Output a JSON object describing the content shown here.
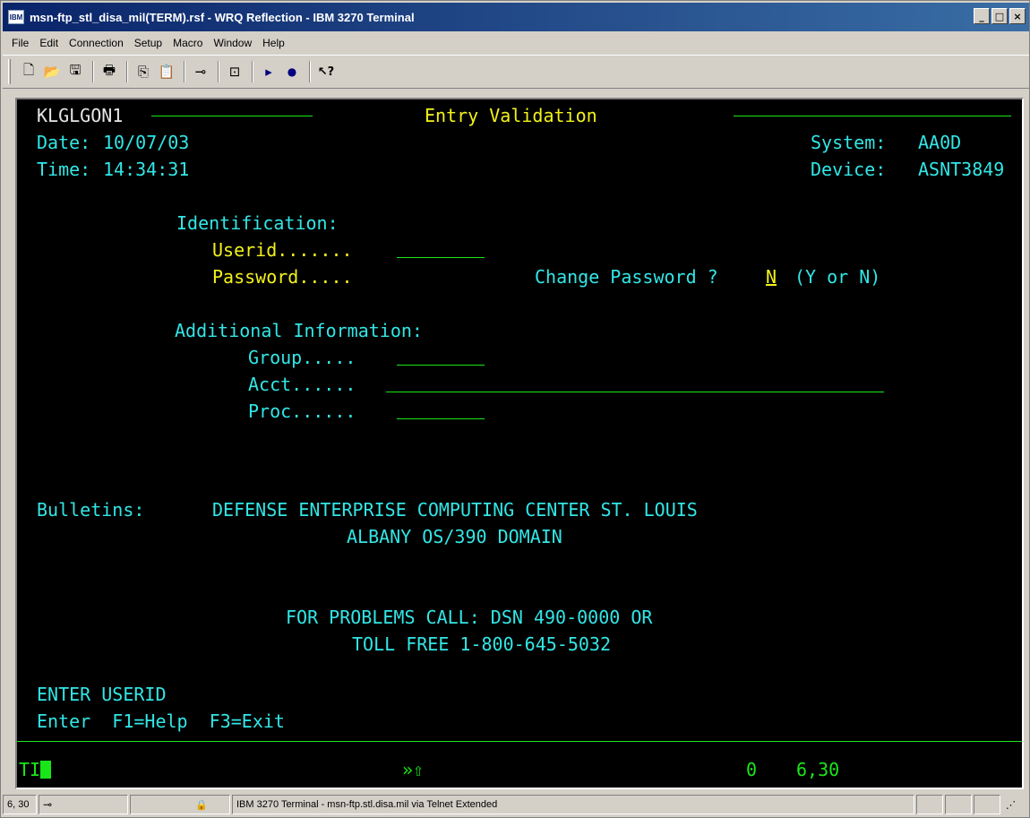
{
  "window": {
    "title": "msn-ftp_stl_disa_mil(TERM).rsf - WRQ Reflection - IBM 3270 Terminal",
    "app_icon_label": "IBM",
    "buttons": {
      "minimize": "_",
      "maximize": "□",
      "close": "×"
    }
  },
  "menu": [
    "File",
    "Edit",
    "Connection",
    "Setup",
    "Macro",
    "Window",
    "Help"
  ],
  "toolbar": {
    "icons": [
      "new-file-icon",
      "open-folder-icon",
      "save-icon",
      "print-icon",
      "copy-icon",
      "paste-icon",
      "connect-icon",
      "disconnect-icon",
      "play-macro-icon",
      "record-macro-icon",
      "context-help-icon"
    ],
    "glyphs": {
      "new": "🗋",
      "open": "📂",
      "save": "🖫",
      "print": "🖶",
      "copy": "⎘",
      "paste": "📋",
      "connect": "⊸",
      "disconnect": "⊡",
      "play": "▸",
      "record": "●",
      "help": "↖?"
    }
  },
  "terminal": {
    "screen_id": "KLGLGON1",
    "title": "Entry Validation",
    "date_label": "Date:",
    "date_value": "10/07/03",
    "time_label": "Time:",
    "time_value": "14:34:31",
    "system_label": "System:",
    "system_value": "AA0D",
    "device_label": "Device:",
    "device_value": "ASNT3849",
    "identification_heading": "Identification:",
    "userid_label": "Userid.......",
    "password_label": "Password.....",
    "change_password_label": "Change Password ?",
    "change_password_value": "N",
    "change_password_hint": "(Y or N)",
    "additional_heading": "Additional Information:",
    "group_label": "Group.....",
    "acct_label": "Acct......",
    "proc_label": "Proc......",
    "bulletins_label": "Bulletins:",
    "bulletin_line1": "DEFENSE ENTERPRISE COMPUTING CENTER ST. LOUIS",
    "bulletin_line2": "ALBANY OS/390 DOMAIN",
    "problems_line1": "FOR PROBLEMS CALL: DSN 490-0000 OR",
    "problems_line2": "TOLL FREE 1-800-645-5032",
    "message": "ENTER USERID",
    "pf_keys": "Enter  F1=Help  F3=Exit"
  },
  "oia": {
    "indicator": "TI",
    "shift_symbol": "»⇧",
    "status_number": "0",
    "cursor_pos": "6,30"
  },
  "statusbar": {
    "cursor_pos": "6, 30",
    "connection_text": "IBM 3270 Terminal - msn-ftp.stl.disa.mil via Telnet Extended"
  },
  "colors": {
    "terminal_bg": "#000000",
    "green": "#19e619",
    "yellow": "#f2f21a",
    "cyan": "#33e6e6",
    "titlebar_start": "#0a246a",
    "titlebar_end": "#3a6ea5"
  }
}
